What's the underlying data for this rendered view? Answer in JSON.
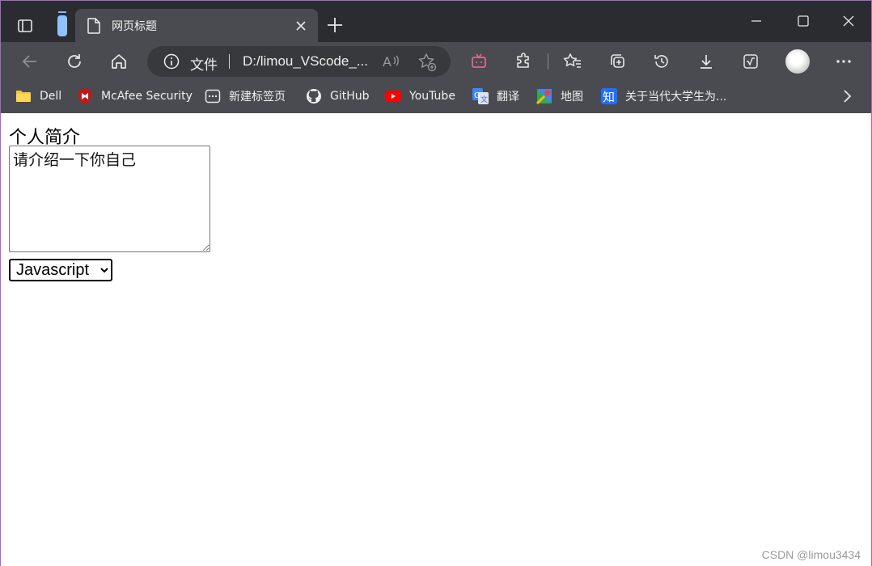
{
  "browser": {
    "tab": {
      "title": "网页标题"
    },
    "address": {
      "site_label": "文件",
      "url": "D:/limou_VScode_..."
    },
    "bookmarks": [
      {
        "label": "Dell",
        "icon": "folder-icon"
      },
      {
        "label": "McAfee Security",
        "icon": "mcafee-icon"
      },
      {
        "label": "新建标签页",
        "icon": "new-tab-page-icon"
      },
      {
        "label": "GitHub",
        "icon": "github-icon"
      },
      {
        "label": "YouTube",
        "icon": "youtube-icon"
      },
      {
        "label": "翻译",
        "icon": "translate-icon"
      },
      {
        "label": "地图",
        "icon": "maps-icon"
      },
      {
        "label": "关于当代大学生为...",
        "icon": "zhihu-icon"
      }
    ]
  },
  "page": {
    "intro_label": "个人简介",
    "textarea_placeholder": "请介绍一下你自己",
    "select": {
      "selected": "Javascript"
    }
  },
  "watermark": "CSDN @limou3434",
  "colors": {
    "titlebar_bg": "#2b2c2f",
    "toolbar_bg": "#4a4b50",
    "addressbar_bg": "#38393c",
    "youtube_red": "#ff0000",
    "mcafee_red": "#c01818"
  }
}
